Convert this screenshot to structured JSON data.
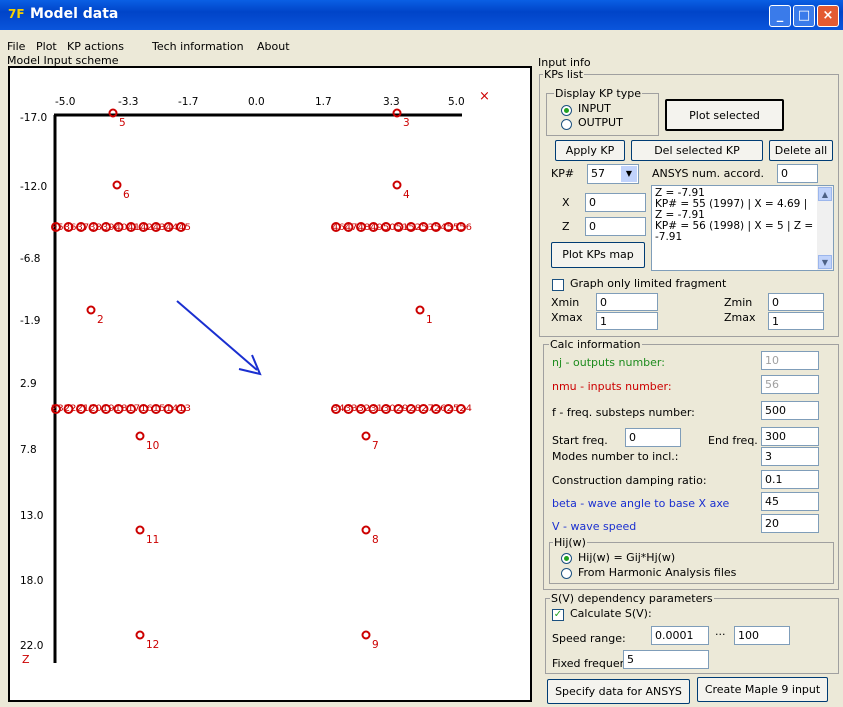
{
  "window": {
    "title": "Model data",
    "icon": "7F"
  },
  "menu": [
    "File",
    "Plot",
    "KP actions",
    "Tech information",
    "About"
  ],
  "plot": {
    "group_label": "Model Input scheme",
    "x_ticks": [
      "-5.0",
      "-3.3",
      "-1.7",
      "0.0",
      "1.7",
      "3.3",
      "5.0"
    ],
    "z_ticks": [
      "-17.0",
      "-12.0",
      "-6.8",
      "-1.9",
      "2.9",
      "7.8",
      "13.0",
      "18.0",
      "22.0"
    ],
    "axis_z_label": "Z",
    "corner_marker": "×",
    "points": [
      {
        "label": "5"
      },
      {
        "label": "3"
      },
      {
        "label": "6"
      },
      {
        "label": "4"
      },
      {
        "label": "2"
      },
      {
        "label": "1"
      },
      {
        "label": "10"
      },
      {
        "label": "7"
      },
      {
        "label": "11"
      },
      {
        "label": "8"
      },
      {
        "label": "12"
      },
      {
        "label": "9"
      }
    ],
    "row_labels": {
      "upper_left": "3536373839404142434445",
      "upper_right": "4647484950515253545556",
      "lower_left": "2322212019181716151413",
      "lower_right": "3433323130292827262524"
    },
    "arrow_color": "#1a2fd0",
    "point_color": "#cc0000"
  },
  "input_info": {
    "label": "Input info",
    "kps_list": "KPs list",
    "display_kp_type": "Display KP type",
    "radio_input": "INPUT",
    "radio_output": "OUTPUT",
    "plot_selected": "Plot selected",
    "apply_kp": "Apply KP",
    "del_selected_kp": "Del selected KP",
    "delete_all": "Delete all",
    "kp_num_label": "KP#",
    "kp_num_value": "57",
    "ansys_label": "ANSYS num. accord.",
    "ansys_value": "0",
    "x_label": "X",
    "x_value": "0",
    "z_label": "Z",
    "z_value": "0",
    "plot_kps_map": "Plot KPs map",
    "kp_text_lines": [
      "Z = -7.91",
      "KP# = 55 (1997) | X = 4.69 |",
      "Z = -7.91",
      "KP# = 56 (1998) | X = 5 | Z =",
      "-7.91"
    ],
    "graph_fragment": "Graph only limited fragment",
    "xmin_label": "Xmin",
    "xmin_value": "0",
    "xmax_label": "Xmax",
    "xmax_value": "1",
    "zmin_label": "Zmin",
    "zmin_value": "0",
    "zmax_label": "Zmax",
    "zmax_value": "1"
  },
  "calc": {
    "label": "Calc information",
    "nj_label": "nj - outputs number:",
    "nj_value": "10",
    "nmu_label": "nmu - inputs number:",
    "nmu_value": "56",
    "f_label": "f - freq. substeps number:",
    "f_value": "500",
    "start_label": "Start freq.",
    "start_value": "0",
    "end_label": "End freq.",
    "end_value": "300",
    "modes_label": "Modes number to incl.:",
    "modes_value": "3",
    "damping_label": "Construction damping ratio:",
    "damping_value": "0.1",
    "beta_label": "beta - wave angle to base X axe",
    "beta_value": "45",
    "v_label": "V - wave speed",
    "v_value": "20",
    "hij_label": "Hij(w)",
    "hij_opt1": "Hij(w) = Gij*Hj(w)",
    "hij_opt2": "From Harmonic Analysis files",
    "nj_color": "#1e8c1e",
    "nmu_color": "#cc0000",
    "beta_color": "#1a2fd0",
    "v_color": "#1a2fd0"
  },
  "sv": {
    "label": "S(V) dependency parameters",
    "calc_label": "Calculate S(V):",
    "speed_label": "Speed range:",
    "speed_from": "0.0001",
    "speed_sep": "...",
    "speed_to": "100",
    "fixed_label": "Fixed frequency:",
    "fixed_value": "5"
  },
  "bottom": {
    "specify": "Specify data for ANSYS",
    "maple": "Create Maple 9 input"
  }
}
